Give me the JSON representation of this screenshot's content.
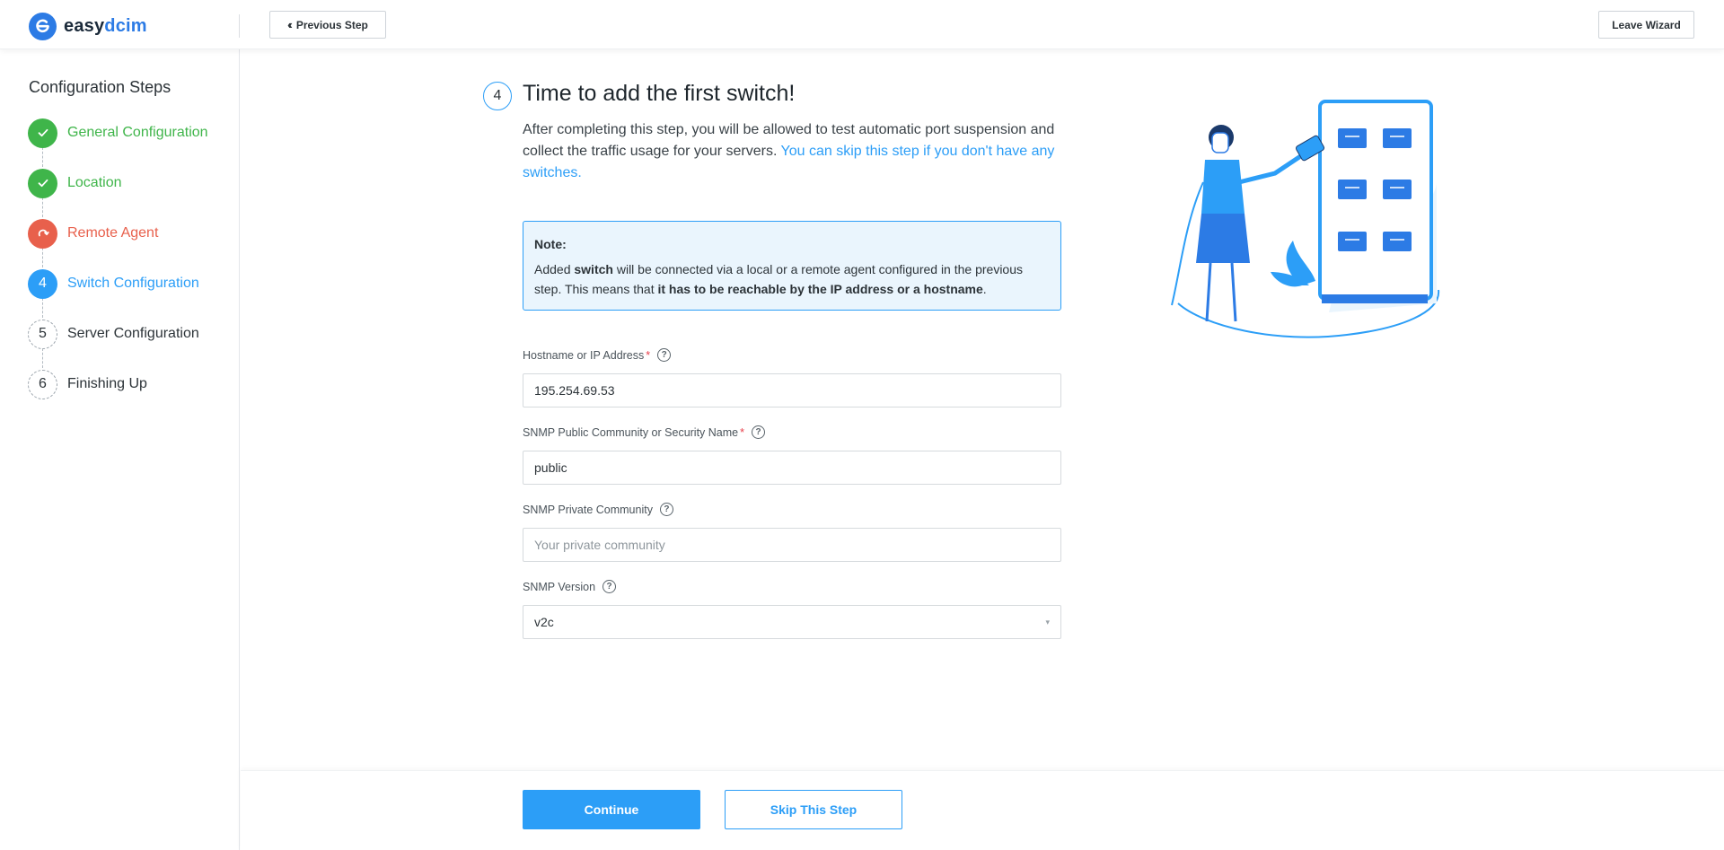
{
  "brand": {
    "name_part1": "easy",
    "name_part2": "dcim",
    "accent_color": "#2c9ef7",
    "logo_color": "#2c7be5"
  },
  "topbar": {
    "previous_step_label": "Previous Step",
    "leave_wizard_label": "Leave Wizard"
  },
  "sidebar": {
    "title": "Configuration Steps",
    "steps": [
      {
        "marker": "",
        "label": "General Configuration",
        "status": "done",
        "icon": "check-icon"
      },
      {
        "marker": "",
        "label": "Location",
        "status": "done",
        "icon": "check-icon"
      },
      {
        "marker": "",
        "label": "Remote Agent",
        "status": "warning",
        "icon": "redo-arrow-icon"
      },
      {
        "marker": "4",
        "label": "Switch Configuration",
        "status": "active"
      },
      {
        "marker": "5",
        "label": "Server Configuration",
        "status": "todo"
      },
      {
        "marker": "6",
        "label": "Finishing Up",
        "status": "todo"
      }
    ]
  },
  "main": {
    "step_number": "4",
    "heading": "Time to add the first switch!",
    "intro_text": "After completing this step, you will be allowed to test automatic port suspension and collect the traffic usage for your servers.",
    "intro_link": "You can skip this step if you don't have any switches.",
    "note": {
      "title": "Note:",
      "part1": "Added ",
      "bold1": "switch",
      "part2": " will be connected via a local or a remote agent configured in the previous step. This means that ",
      "bold2": "it has to be reachable by the IP address or a hostname",
      "part3": "."
    },
    "fields": {
      "hostname": {
        "label": "Hostname or IP Address",
        "value": "195.254.69.53",
        "required": true
      },
      "public_community": {
        "label": "SNMP Public Community or Security Name",
        "value": "public",
        "required": true
      },
      "private_community": {
        "label": "SNMP Private Community",
        "value": "",
        "placeholder": "Your private community",
        "required": false
      },
      "snmp_version": {
        "label": "SNMP Version",
        "value": "v2c",
        "required": false
      }
    }
  },
  "footer": {
    "continue_label": "Continue",
    "skip_label": "Skip This Step"
  }
}
